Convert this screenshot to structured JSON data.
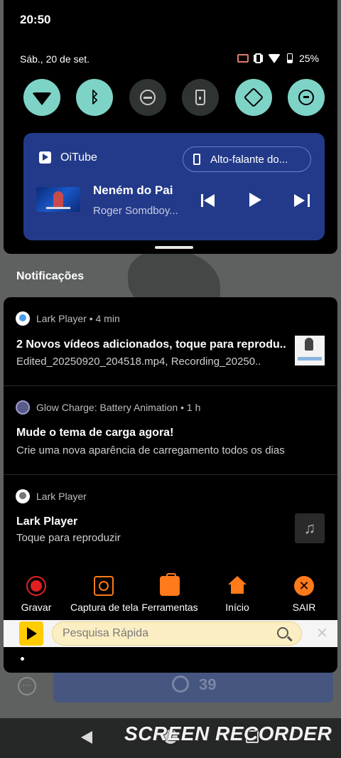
{
  "status": {
    "time": "20:50",
    "date": "Sáb., 20 de set.",
    "battery": "25%"
  },
  "quick_settings": [
    {
      "name": "wifi",
      "icon": "wifi-icon",
      "active": true
    },
    {
      "name": "bluetooth",
      "icon": "bluetooth-icon",
      "active": true
    },
    {
      "name": "do-not-disturb",
      "icon": "dnd-icon",
      "active": false
    },
    {
      "name": "flashlight",
      "icon": "flashlight-icon",
      "active": false
    },
    {
      "name": "auto-rotate",
      "icon": "rotate-icon",
      "active": true
    },
    {
      "name": "data-saver",
      "icon": "sync-icon",
      "active": true
    }
  ],
  "media": {
    "app": "OiTube",
    "output": "Alto-falante do...",
    "title": "Neném do Pai",
    "artist": "Roger Somdboy...",
    "card_color": "#233a8a"
  },
  "notifications_header": "Notificações",
  "notifications": [
    {
      "app": "Lark Player",
      "time": "4 min",
      "title": "2 Novos vídeos adicionados, toque para reprodu..",
      "text": "Edited_20250920_204518.mp4, Recording_20250.."
    },
    {
      "app": "Glow Charge: Battery Animation",
      "time": "1 h",
      "title": "Mude o tema de carga agora!",
      "text": "Crie uma nova aparência de carregamento todos os dias"
    },
    {
      "app": "Lark Player",
      "title": "Lark Player",
      "text": "Toque para reproduzir"
    }
  ],
  "recorder_toolbar": {
    "record": "Gravar",
    "capture": "Captura de tela",
    "tools": "Ferramentas",
    "home": "Início",
    "exit": "SAIR",
    "exit_symbol": "✕",
    "accent": "#ff7a1a"
  },
  "search": {
    "placeholder": "Pesquisa Rápida",
    "close_symbol": "✕"
  },
  "background": {
    "button_text": "39",
    "dots": "⋯"
  },
  "watermark": "SCREEN RECORDER",
  "separator": "•",
  "music_symbol": "♫",
  "bluetooth_symbol": "ᛒ"
}
